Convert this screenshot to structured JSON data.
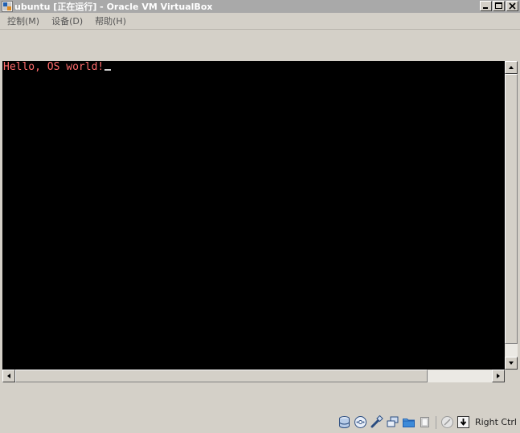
{
  "window": {
    "title": "ubuntu [正在运行] - Oracle VM VirtualBox",
    "buttons": [
      "minimize",
      "maximize",
      "close"
    ]
  },
  "menu": {
    "items": [
      {
        "label": "控制(M)"
      },
      {
        "label": "设备(D)"
      },
      {
        "label": "帮助(H)"
      }
    ]
  },
  "console": {
    "text": "Hello, OS world!",
    "text_color": "#ff6b6b",
    "background": "#000000"
  },
  "status": {
    "icons": [
      "hard-disk-icon",
      "optical-drive-icon",
      "usb-icon",
      "network-icon",
      "shared-folders-icon",
      "display-icon",
      "mouse-integration-icon",
      "host-key-icon"
    ],
    "host_key_label": "Right Ctrl"
  },
  "colors": {
    "titlebar": "#a9a9a9",
    "chrome": "#d4d0c8"
  }
}
